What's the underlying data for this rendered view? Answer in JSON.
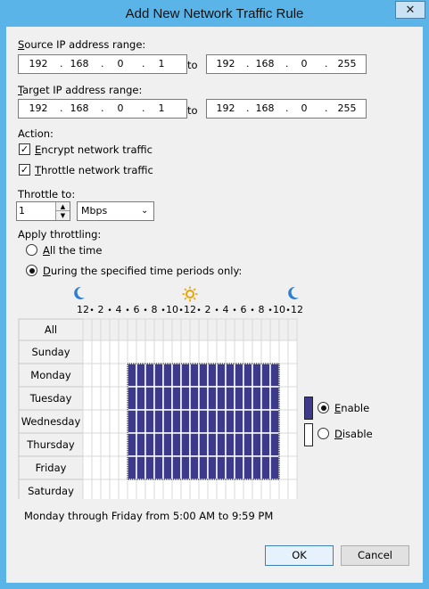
{
  "window": {
    "title": "Add New Network Traffic Rule",
    "close_glyph": "✕"
  },
  "source": {
    "label": "Source IP address range:",
    "from": [
      "192",
      "168",
      "0",
      "1"
    ],
    "to_label": "to",
    "to": [
      "192",
      "168",
      "0",
      "255"
    ]
  },
  "target": {
    "label": "Target IP address range:",
    "from": [
      "192",
      "168",
      "0",
      "1"
    ],
    "to_label": "to",
    "to": [
      "192",
      "168",
      "0",
      "255"
    ]
  },
  "action": {
    "label": "Action:",
    "encrypt": {
      "label": "Encrypt network traffic",
      "checked": true
    },
    "throttle": {
      "label": "Throttle network traffic",
      "checked": true
    }
  },
  "throttle_to": {
    "label": "Throttle to:",
    "value": "1",
    "unit": "Mbps"
  },
  "apply": {
    "label": "Apply throttling:",
    "all_time": "All the time",
    "periods": "During the specified time periods only:",
    "selected": "periods"
  },
  "schedule": {
    "hour_labels": [
      "12",
      "2",
      "4",
      "6",
      "8",
      "10",
      "12",
      "2",
      "4",
      "6",
      "8",
      "10",
      "12"
    ],
    "all_label": "All",
    "days": [
      "Sunday",
      "Monday",
      "Tuesday",
      "Wednesday",
      "Thursday",
      "Friday",
      "Saturday"
    ],
    "enabled_days": [
      1,
      2,
      3,
      4,
      5
    ],
    "enabled_hour_start": 5,
    "enabled_hour_end": 22,
    "enable_color": "#3d3a8c",
    "grid_line_color": "#d8d8d8",
    "summary": "Monday through Friday from 5:00 AM to 9:59 PM"
  },
  "legend": {
    "enable": "Enable",
    "disable": "Disable",
    "selected": "enable"
  },
  "buttons": {
    "ok": "OK",
    "cancel": "Cancel"
  },
  "colors": {
    "frame": "#5ab4e8",
    "client": "#f0f0f0",
    "sun": "#e6a400",
    "moon": "#2f7fd0"
  }
}
